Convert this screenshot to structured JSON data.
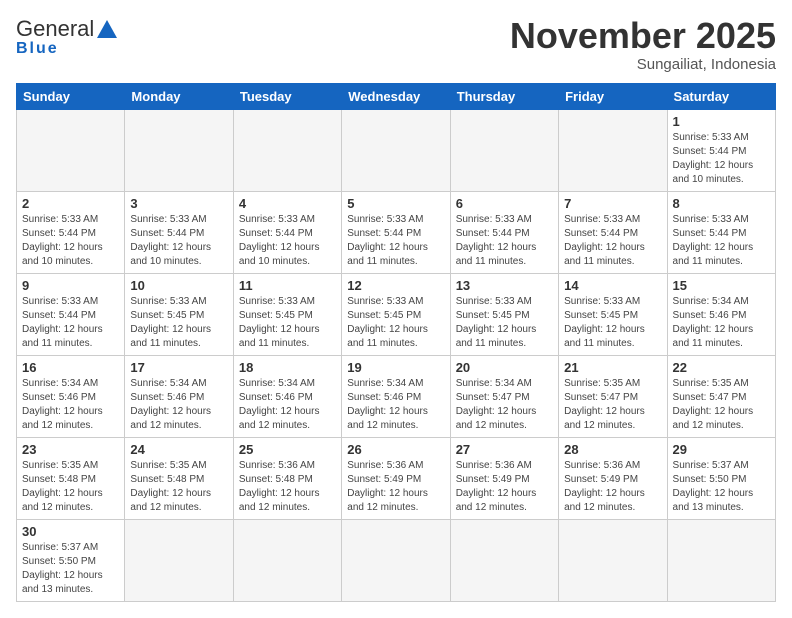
{
  "header": {
    "logo_general": "General",
    "logo_blue": "Blue",
    "month_title": "November 2025",
    "location": "Sungailiat, Indonesia"
  },
  "days_of_week": [
    "Sunday",
    "Monday",
    "Tuesday",
    "Wednesday",
    "Thursday",
    "Friday",
    "Saturday"
  ],
  "weeks": [
    [
      {
        "day": "",
        "info": ""
      },
      {
        "day": "",
        "info": ""
      },
      {
        "day": "",
        "info": ""
      },
      {
        "day": "",
        "info": ""
      },
      {
        "day": "",
        "info": ""
      },
      {
        "day": "",
        "info": ""
      },
      {
        "day": "1",
        "info": "Sunrise: 5:33 AM\nSunset: 5:44 PM\nDaylight: 12 hours\nand 10 minutes."
      }
    ],
    [
      {
        "day": "2",
        "info": "Sunrise: 5:33 AM\nSunset: 5:44 PM\nDaylight: 12 hours\nand 10 minutes."
      },
      {
        "day": "3",
        "info": "Sunrise: 5:33 AM\nSunset: 5:44 PM\nDaylight: 12 hours\nand 10 minutes."
      },
      {
        "day": "4",
        "info": "Sunrise: 5:33 AM\nSunset: 5:44 PM\nDaylight: 12 hours\nand 10 minutes."
      },
      {
        "day": "5",
        "info": "Sunrise: 5:33 AM\nSunset: 5:44 PM\nDaylight: 12 hours\nand 11 minutes."
      },
      {
        "day": "6",
        "info": "Sunrise: 5:33 AM\nSunset: 5:44 PM\nDaylight: 12 hours\nand 11 minutes."
      },
      {
        "day": "7",
        "info": "Sunrise: 5:33 AM\nSunset: 5:44 PM\nDaylight: 12 hours\nand 11 minutes."
      },
      {
        "day": "8",
        "info": "Sunrise: 5:33 AM\nSunset: 5:44 PM\nDaylight: 12 hours\nand 11 minutes."
      }
    ],
    [
      {
        "day": "9",
        "info": "Sunrise: 5:33 AM\nSunset: 5:44 PM\nDaylight: 12 hours\nand 11 minutes."
      },
      {
        "day": "10",
        "info": "Sunrise: 5:33 AM\nSunset: 5:45 PM\nDaylight: 12 hours\nand 11 minutes."
      },
      {
        "day": "11",
        "info": "Sunrise: 5:33 AM\nSunset: 5:45 PM\nDaylight: 12 hours\nand 11 minutes."
      },
      {
        "day": "12",
        "info": "Sunrise: 5:33 AM\nSunset: 5:45 PM\nDaylight: 12 hours\nand 11 minutes."
      },
      {
        "day": "13",
        "info": "Sunrise: 5:33 AM\nSunset: 5:45 PM\nDaylight: 12 hours\nand 11 minutes."
      },
      {
        "day": "14",
        "info": "Sunrise: 5:33 AM\nSunset: 5:45 PM\nDaylight: 12 hours\nand 11 minutes."
      },
      {
        "day": "15",
        "info": "Sunrise: 5:34 AM\nSunset: 5:46 PM\nDaylight: 12 hours\nand 11 minutes."
      }
    ],
    [
      {
        "day": "16",
        "info": "Sunrise: 5:34 AM\nSunset: 5:46 PM\nDaylight: 12 hours\nand 12 minutes."
      },
      {
        "day": "17",
        "info": "Sunrise: 5:34 AM\nSunset: 5:46 PM\nDaylight: 12 hours\nand 12 minutes."
      },
      {
        "day": "18",
        "info": "Sunrise: 5:34 AM\nSunset: 5:46 PM\nDaylight: 12 hours\nand 12 minutes."
      },
      {
        "day": "19",
        "info": "Sunrise: 5:34 AM\nSunset: 5:46 PM\nDaylight: 12 hours\nand 12 minutes."
      },
      {
        "day": "20",
        "info": "Sunrise: 5:34 AM\nSunset: 5:47 PM\nDaylight: 12 hours\nand 12 minutes."
      },
      {
        "day": "21",
        "info": "Sunrise: 5:35 AM\nSunset: 5:47 PM\nDaylight: 12 hours\nand 12 minutes."
      },
      {
        "day": "22",
        "info": "Sunrise: 5:35 AM\nSunset: 5:47 PM\nDaylight: 12 hours\nand 12 minutes."
      }
    ],
    [
      {
        "day": "23",
        "info": "Sunrise: 5:35 AM\nSunset: 5:48 PM\nDaylight: 12 hours\nand 12 minutes."
      },
      {
        "day": "24",
        "info": "Sunrise: 5:35 AM\nSunset: 5:48 PM\nDaylight: 12 hours\nand 12 minutes."
      },
      {
        "day": "25",
        "info": "Sunrise: 5:36 AM\nSunset: 5:48 PM\nDaylight: 12 hours\nand 12 minutes."
      },
      {
        "day": "26",
        "info": "Sunrise: 5:36 AM\nSunset: 5:49 PM\nDaylight: 12 hours\nand 12 minutes."
      },
      {
        "day": "27",
        "info": "Sunrise: 5:36 AM\nSunset: 5:49 PM\nDaylight: 12 hours\nand 12 minutes."
      },
      {
        "day": "28",
        "info": "Sunrise: 5:36 AM\nSunset: 5:49 PM\nDaylight: 12 hours\nand 12 minutes."
      },
      {
        "day": "29",
        "info": "Sunrise: 5:37 AM\nSunset: 5:50 PM\nDaylight: 12 hours\nand 13 minutes."
      }
    ],
    [
      {
        "day": "30",
        "info": "Sunrise: 5:37 AM\nSunset: 5:50 PM\nDaylight: 12 hours\nand 13 minutes."
      },
      {
        "day": "",
        "info": ""
      },
      {
        "day": "",
        "info": ""
      },
      {
        "day": "",
        "info": ""
      },
      {
        "day": "",
        "info": ""
      },
      {
        "day": "",
        "info": ""
      },
      {
        "day": "",
        "info": ""
      }
    ]
  ]
}
